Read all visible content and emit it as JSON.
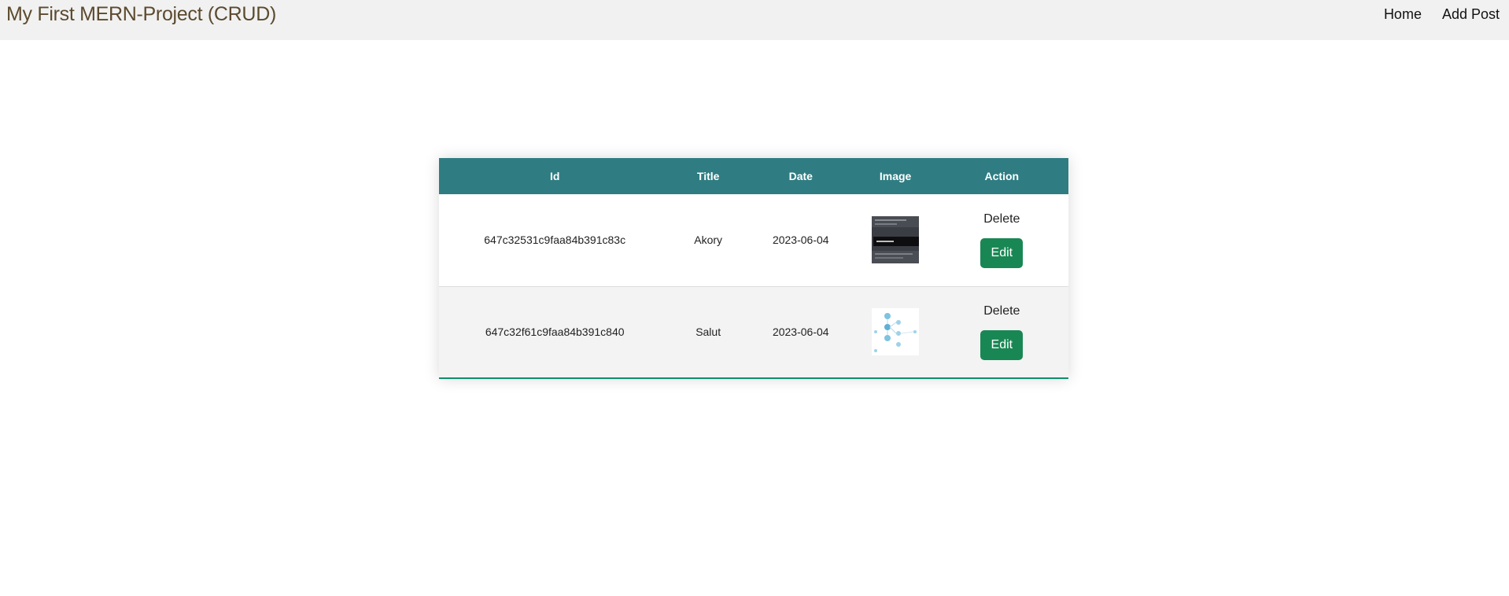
{
  "navbar": {
    "brand": "My First MERN-Project (CRUD)",
    "links": [
      "Home",
      "Add Post"
    ]
  },
  "table": {
    "headers": [
      "Id",
      "Title",
      "Date",
      "Image",
      "Action"
    ],
    "rows": [
      {
        "id": "647c32531c9faa84b391c83c",
        "title": "Akory",
        "date": "2023-06-04",
        "image": "dark-screenshot-thumbnail",
        "delete_label": "Delete",
        "edit_label": "Edit"
      },
      {
        "id": "647c32f61c9faa84b391c840",
        "title": "Salut",
        "date": "2023-06-04",
        "image": "diagram-thumbnail",
        "delete_label": "Delete",
        "edit_label": "Edit"
      }
    ]
  },
  "colors": {
    "header_bg": "#2f7d82",
    "edit_button": "#198754",
    "brand_text": "#5c4a2e",
    "navbar_bg": "#f1f1f1"
  }
}
